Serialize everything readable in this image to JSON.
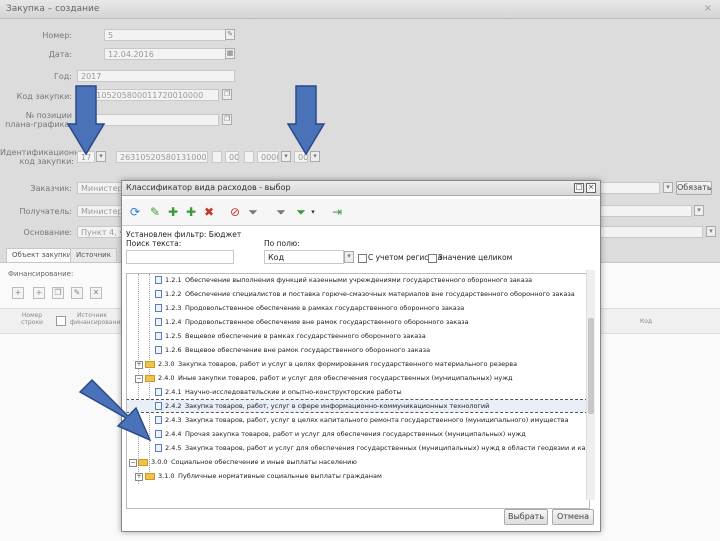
{
  "window": {
    "title": "Закупка – создание",
    "close": "×"
  },
  "form": {
    "number": {
      "label": "Номер:",
      "value": "5"
    },
    "date": {
      "label": "Дата:",
      "value": "12.04.2016"
    },
    "year": {
      "label": "Год:",
      "value": "2017"
    },
    "purchase_code": {
      "label": "Код закупки:",
      "value": "173105205800011720010000"
    },
    "plan_number": {
      "label": "№ позиции плана-графика:",
      "value": ""
    },
    "ikz": {
      "label": "Идентификационный код закупки:",
      "parts": [
        "17",
        "263105205801310001",
        "000",
        "0000",
        "000"
      ]
    },
    "customer": {
      "label": "Заказчик:",
      "value": "Министерство"
    },
    "recipient": {
      "label": "Получатель:",
      "value": "Министерство..."
    },
    "basis": {
      "label": "Основание:",
      "value": "Пункт 4, ч. 1..."
    },
    "button_choose": "Обязать"
  },
  "tabs": [
    "Объект закупки",
    "Источник"
  ],
  "subsection_label": "Финансирование:",
  "table_header": {
    "col1": "Номер строки",
    "col2": "Источник финансирования",
    "col3": "Код"
  },
  "dialog": {
    "title": "Классификатор вида расходов - выбор",
    "filter_label": "Установлен фильтр: Бюджет",
    "search_text_label": "Поиск текста:",
    "search_text_value": "",
    "by_field_label": "По полю:",
    "by_field_value": "Код",
    "case_sensitive": "С учетом регистра",
    "whole_value": "Значение целиком",
    "tree": [
      {
        "code": "1.2.1",
        "text": "Обеспечение выполнения функций казенными учреждениями государственного оборонного заказа"
      },
      {
        "code": "1.2.2",
        "text": "Обеспечение специалистов и поставка горюче-смазочных материалов вне государственного оборонного заказа"
      },
      {
        "code": "1.2.3",
        "text": "Продовольственное обеспечение в рамках государственного оборонного заказа"
      },
      {
        "code": "1.2.4",
        "text": "Продовольственное обеспечение вне рамок государственного оборонного заказа"
      },
      {
        "code": "1.2.5",
        "text": "Вещевое обеспечение в рамках государственного оборонного заказа"
      },
      {
        "code": "1.2.6",
        "text": "Вещевое обеспечение вне рамок государственного оборонного заказа"
      },
      {
        "code": "2.3.0",
        "text": "Закупка товаров, работ и услуг в целях формирования государственного материального резерва"
      },
      {
        "code": "2.4.0",
        "text": "Иные закупки товаров, работ и услуг для обеспечения государственных (муниципальных) нужд"
      },
      {
        "code": "2.4.1",
        "text": "Научно-исследовательские и опытно-конструкторские работы"
      },
      {
        "code": "2.4.2",
        "text": "Закупка товаров, работ, услуг в сфере информационно-коммуникационных технологий"
      },
      {
        "code": "2.4.3",
        "text": "Закупка товаров, работ, услуг в целях капитального ремонта государственного (муниципального) имущества"
      },
      {
        "code": "2.4.4",
        "text": "Прочая закупка товаров, работ и услуг для обеспечения государственных (муниципальных) нужд"
      },
      {
        "code": "2.4.5",
        "text": "Закупка товаров, работ и услуг для обеспечения государственных (муниципальных) нужд в области геодезии и картографии вне рамок государственного оборонного заказа"
      },
      {
        "code": "3.0.0",
        "text": "Социальное обеспечение и иные выплаты населению"
      },
      {
        "code": "3.1.0",
        "text": "Публичные нормативные социальные выплаты гражданам"
      }
    ],
    "ok": "Выбрать",
    "cancel": "Отмена"
  },
  "colors": {
    "arrow": "#4a72b8",
    "arrow_stroke": "#2a4a88",
    "selection": "#e9eef7"
  }
}
